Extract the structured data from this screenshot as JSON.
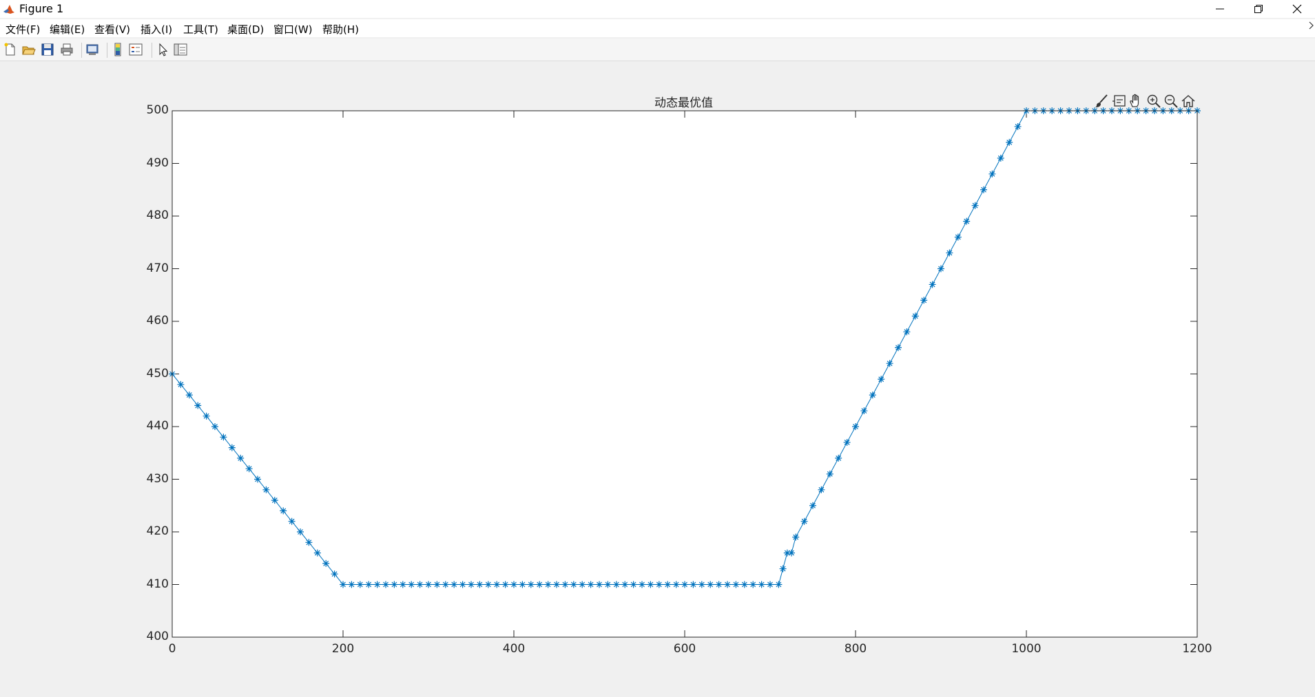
{
  "window": {
    "title": "Figure 1",
    "app_icon": "matlab-icon",
    "controls": [
      "minimize-icon",
      "restore-icon",
      "close-icon"
    ]
  },
  "menu": {
    "items": [
      {
        "label": "文件(F)"
      },
      {
        "label": "编辑(E)"
      },
      {
        "label": "查看(V)"
      },
      {
        "label": "插入(I)"
      },
      {
        "label": "工具(T)"
      },
      {
        "label": "桌面(D)"
      },
      {
        "label": "窗口(W)"
      },
      {
        "label": "帮助(H)"
      }
    ]
  },
  "toolbar": {
    "buttons": [
      "new-figure-icon",
      "open-file-icon",
      "save-icon",
      "print-icon",
      "print-preview-icon",
      "colorbar-icon",
      "legend-icon",
      "pointer-icon",
      "property-inspector-icon"
    ]
  },
  "axes_toolbar": {
    "buttons": [
      "brush-icon",
      "datatip-icon",
      "pan-icon",
      "zoom-in-icon",
      "zoom-out-icon",
      "home-icon"
    ]
  },
  "colors": {
    "series": "#0072bd",
    "axis": "#262626",
    "figure_bg": "#f0f0f0",
    "plot_bg": "#ffffff"
  },
  "chart_data": {
    "type": "line",
    "title": "动态最优值",
    "xlabel": "",
    "ylabel": "",
    "xlim": [
      0,
      1200
    ],
    "ylim": [
      400,
      500
    ],
    "xticks": [
      0,
      200,
      400,
      600,
      800,
      1000,
      1200
    ],
    "yticks": [
      400,
      410,
      420,
      430,
      440,
      450,
      460,
      470,
      480,
      490,
      500
    ],
    "xtick_labels": [
      "0",
      "200",
      "400",
      "600",
      "800",
      "1000",
      "1200"
    ],
    "ytick_labels": [
      "400",
      "410",
      "420",
      "430",
      "440",
      "450",
      "460",
      "470",
      "480",
      "490",
      "500"
    ],
    "grid": false,
    "marker": "asterisk",
    "series": [
      {
        "values_summary_points": [
          [
            0,
            450
          ],
          [
            10,
            448
          ],
          [
            20,
            446
          ],
          [
            30,
            444
          ],
          [
            40,
            442
          ],
          [
            50,
            440
          ],
          [
            60,
            438
          ],
          [
            70,
            436
          ],
          [
            80,
            434
          ],
          [
            90,
            432
          ],
          [
            100,
            430
          ],
          [
            110,
            428
          ],
          [
            120,
            426
          ],
          [
            130,
            424
          ],
          [
            140,
            422
          ],
          [
            150,
            420
          ],
          [
            160,
            418
          ],
          [
            170,
            416
          ],
          [
            180,
            414
          ],
          [
            190,
            412
          ],
          [
            200,
            410
          ],
          [
            210,
            410
          ],
          [
            220,
            410
          ],
          [
            230,
            410
          ],
          [
            240,
            410
          ],
          [
            250,
            410
          ],
          [
            260,
            410
          ],
          [
            270,
            410
          ],
          [
            280,
            410
          ],
          [
            290,
            410
          ],
          [
            300,
            410
          ],
          [
            310,
            410
          ],
          [
            320,
            410
          ],
          [
            330,
            410
          ],
          [
            340,
            410
          ],
          [
            350,
            410
          ],
          [
            360,
            410
          ],
          [
            370,
            410
          ],
          [
            380,
            410
          ],
          [
            390,
            410
          ],
          [
            400,
            410
          ],
          [
            410,
            410
          ],
          [
            420,
            410
          ],
          [
            430,
            410
          ],
          [
            440,
            410
          ],
          [
            450,
            410
          ],
          [
            460,
            410
          ],
          [
            470,
            410
          ],
          [
            480,
            410
          ],
          [
            490,
            410
          ],
          [
            500,
            410
          ],
          [
            510,
            410
          ],
          [
            520,
            410
          ],
          [
            530,
            410
          ],
          [
            540,
            410
          ],
          [
            550,
            410
          ],
          [
            560,
            410
          ],
          [
            570,
            410
          ],
          [
            580,
            410
          ],
          [
            590,
            410
          ],
          [
            600,
            410
          ],
          [
            610,
            410
          ],
          [
            620,
            410
          ],
          [
            630,
            410
          ],
          [
            640,
            410
          ],
          [
            650,
            410
          ],
          [
            660,
            410
          ],
          [
            670,
            410
          ],
          [
            680,
            410
          ],
          [
            690,
            410
          ],
          [
            700,
            410
          ],
          [
            710,
            410
          ],
          [
            715,
            413
          ],
          [
            720,
            416
          ],
          [
            725,
            416
          ],
          [
            730,
            419
          ],
          [
            740,
            422
          ],
          [
            750,
            425
          ],
          [
            760,
            428
          ],
          [
            770,
            431
          ],
          [
            780,
            434
          ],
          [
            790,
            437
          ],
          [
            800,
            440
          ],
          [
            810,
            443
          ],
          [
            820,
            446
          ],
          [
            830,
            449
          ],
          [
            840,
            452
          ],
          [
            850,
            455
          ],
          [
            860,
            458
          ],
          [
            870,
            461
          ],
          [
            880,
            464
          ],
          [
            890,
            467
          ],
          [
            900,
            470
          ],
          [
            910,
            473
          ],
          [
            920,
            476
          ],
          [
            930,
            479
          ],
          [
            940,
            482
          ],
          [
            950,
            485
          ],
          [
            960,
            488
          ],
          [
            970,
            491
          ],
          [
            980,
            494
          ],
          [
            990,
            497
          ],
          [
            1000,
            500
          ],
          [
            1010,
            500
          ],
          [
            1020,
            500
          ],
          [
            1030,
            500
          ],
          [
            1040,
            500
          ],
          [
            1050,
            500
          ],
          [
            1060,
            500
          ],
          [
            1070,
            500
          ],
          [
            1080,
            500
          ],
          [
            1090,
            500
          ],
          [
            1100,
            500
          ],
          [
            1110,
            500
          ],
          [
            1120,
            500
          ],
          [
            1130,
            500
          ],
          [
            1140,
            500
          ],
          [
            1150,
            500
          ],
          [
            1160,
            500
          ],
          [
            1170,
            500
          ],
          [
            1180,
            500
          ],
          [
            1190,
            500
          ],
          [
            1200,
            500
          ]
        ]
      }
    ]
  }
}
